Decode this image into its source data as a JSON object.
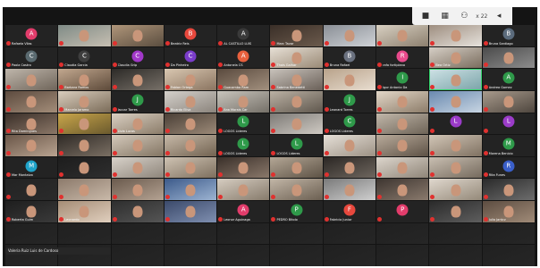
{
  "toolbar": {
    "icons": [
      "stop-icon",
      "gallery-icon",
      "group-icon",
      "minimize-icon"
    ],
    "label": "x 22",
    "glyphs": [
      "■",
      "▦",
      "⚇",
      "◂"
    ]
  },
  "name_pill": "Valeria Ruiz Luis de Cardoso",
  "colors": {
    "background": "#141414",
    "tile": "#232323",
    "mute": "#e0312f",
    "active_speaker": "#35d36b"
  },
  "participants": [
    {
      "name": "Rafaela Vilas",
      "initial": "A",
      "color": "#e23c6b"
    },
    {
      "name": "",
      "video": [
        "#7f8b86",
        "#c7bfb2"
      ]
    },
    {
      "name": "",
      "video": [
        "#b0967a",
        "#5a4d3f"
      ]
    },
    {
      "name": "Beatriz Reis",
      "initial": "B",
      "color": "#e8483d"
    },
    {
      "name": "AL CASTILLO LUIS",
      "initial": "A",
      "color": "#3a3a3a"
    },
    {
      "name": "Marc Tavar",
      "video": [
        "#3a2f28",
        "#6b5a4c"
      ]
    },
    {
      "name": "",
      "video": [
        "#8a8f96",
        "#cfd2d6"
      ]
    },
    {
      "name": "",
      "video": [
        "#d8d0c2",
        "#8c7f6e"
      ]
    },
    {
      "name": "",
      "video": [
        "#9e8e80",
        "#e6e2dc"
      ]
    },
    {
      "name": "Bruna Santiago",
      "initial": "B",
      "color": "#5b6b7c"
    },
    {
      "name": "Paola Castro",
      "initial": "C",
      "color": "#5a6a70"
    },
    {
      "name": "Claudia Garcia",
      "initial": "C",
      "color": "#3e3e3e"
    },
    {
      "name": "Claudia Grip",
      "initial": "C",
      "color": "#a138c9"
    },
    {
      "name": "Da Pinheiro",
      "initial": "C",
      "color": "#7a3cc9"
    },
    {
      "name": "Antonela CS",
      "initial": "A",
      "color": "#e8603d"
    },
    {
      "name": "Thais Galhar",
      "video": [
        "#e7e0d6",
        "#9a8a76"
      ]
    },
    {
      "name": "Bruna Rafael",
      "initial": "B",
      "color": "#6b7280"
    },
    {
      "name": "rafa fortiplano",
      "initial": "R",
      "color": "#e84a8c"
    },
    {
      "name": "Bea Ortiz",
      "video": [
        "#d6cfc6",
        "#7a6d5e"
      ]
    },
    {
      "name": "",
      "video": [
        "#4b4b4b",
        "#8d8d8d"
      ]
    },
    {
      "name": "",
      "video": [
        "#bfb6ab",
        "#6f655a"
      ]
    },
    {
      "name": "Barbara Ramos",
      "video": [
        "#c2a88f",
        "#5d4a3a"
      ]
    },
    {
      "name": "",
      "video": [
        "#2c2a27",
        "#777068"
      ]
    },
    {
      "name": "Fabian Ortega",
      "video": [
        "#d9c7b1",
        "#8a7460"
      ]
    },
    {
      "name": "Guacamba Ram",
      "video": [
        "#5a4a3e",
        "#a2907e"
      ]
    },
    {
      "name": "Sabrina Benedetti",
      "video": [
        "#c9c3bc",
        "#6a6058"
      ]
    },
    {
      "name": "",
      "video": [
        "#b8a28a",
        "#e8ddd0"
      ]
    },
    {
      "name": "Igor Antonio Da",
      "initial": "I",
      "color": "#2f9a4a"
    },
    {
      "name": "",
      "video": [
        "#cfe3e6",
        "#7aa3a8"
      ],
      "talking": true
    },
    {
      "name": "Andrea Gomez",
      "initial": "A",
      "color": "#2f9a4a"
    },
    {
      "name": "",
      "video": [
        "#5d4b3f",
        "#a38d79"
      ]
    },
    {
      "name": "Marcelo Jaramo",
      "video": [
        "#d9cdbd",
        "#7a6b58"
      ]
    },
    {
      "name": "Jaccar Torres",
      "initial": "J",
      "color": "#2f9a4a"
    },
    {
      "name": "Ricardo Elisa",
      "video": [
        "#d4d0cb",
        "#8b847c"
      ]
    },
    {
      "name": "Ana Morais Car",
      "video": [
        "#c8c4bc",
        "#757068"
      ]
    },
    {
      "name": "",
      "video": [
        "#bbb1a4",
        "#5f574d"
      ]
    },
    {
      "name": "Leonard Torres",
      "initial": "J",
      "color": "#2f9a4a"
    },
    {
      "name": "",
      "video": [
        "#e3d7c8",
        "#8c7c69"
      ]
    },
    {
      "name": "",
      "video": [
        "#6a8ab0",
        "#c8d5e2"
      ]
    },
    {
      "name": "",
      "video": [
        "#a89a8c",
        "#4e463e"
      ]
    },
    {
      "name": "Rita Domingues",
      "video": [
        "#3a2f29",
        "#8b7767"
      ]
    },
    {
      "name": "",
      "video": [
        "#c9a64a",
        "#6b5a2e"
      ]
    },
    {
      "name": "Livia Lucas",
      "video": [
        "#d9cfc2",
        "#8b7c69"
      ]
    },
    {
      "name": "",
      "video": [
        "#4a3f36",
        "#9c8a78"
      ]
    },
    {
      "name": "LOGOS Lideres",
      "initial": "L",
      "color": "#2f9a4a"
    },
    {
      "name": "",
      "video": [
        "#7d7a76",
        "#cfcac3"
      ]
    },
    {
      "name": "LOGOS Lideres",
      "initial": "C",
      "color": "#2f9a4a"
    },
    {
      "name": "",
      "video": [
        "#c1b7aa",
        "#6e6457"
      ]
    },
    {
      "name": "",
      "initial": "L",
      "color": "#9b3cc9"
    },
    {
      "name": "",
      "initial": "L",
      "color": "#9b3cc9"
    },
    {
      "name": "",
      "video": [
        "#6a5648",
        "#b8a390"
      ]
    },
    {
      "name": "",
      "video": [
        "#2f2a26",
        "#7a6f63"
      ]
    },
    {
      "name": "",
      "video": [
        "#d4c9bb",
        "#837563"
      ]
    },
    {
      "name": "",
      "video": [
        "#c7b9a8",
        "#726351"
      ]
    },
    {
      "name": "LOGOS Lideres",
      "initial": "L",
      "color": "#2f9a4a"
    },
    {
      "name": "LOGOS Lideres",
      "initial": "L",
      "color": "#2f9a4a"
    },
    {
      "name": "",
      "video": [
        "#e6e0d8",
        "#9c9184"
      ]
    },
    {
      "name": "",
      "video": [
        "#b9ab9b",
        "#5e5246"
      ]
    },
    {
      "name": "",
      "video": [
        "#d2c6b7",
        "#7f7161"
      ]
    },
    {
      "name": "Morena Benicio",
      "initial": "M",
      "color": "#2f9a4a"
    },
    {
      "name": "Mar Montalvo",
      "initial": "M",
      "color": "#1fa3c9"
    },
    {
      "name": "",
      "video": [
        "#1d1d1d",
        "#2e2e2e"
      ]
    },
    {
      "name": "",
      "video": [
        "#d8d2ca",
        "#8e857a"
      ]
    },
    {
      "name": "",
      "video": [
        "#cfc3b3",
        "#7d6f5e"
      ]
    },
    {
      "name": "",
      "video": [
        "#3a302a",
        "#8a786a"
      ]
    },
    {
      "name": "",
      "video": [
        "#b4a796",
        "#5d5245"
      ]
    },
    {
      "name": "",
      "video": [
        "#2b2724",
        "#6e665e"
      ]
    },
    {
      "name": "",
      "video": [
        "#ddd6cd",
        "#8f8578"
      ]
    },
    {
      "name": "",
      "video": [
        "#c9bfb2",
        "#756a5d"
      ]
    },
    {
      "name": "Rita Funes",
      "initial": "R",
      "color": "#3a5fc9"
    },
    {
      "name": "",
      "video": [
        "#232323",
        "#2b2b2b"
      ]
    },
    {
      "name": "",
      "video": [
        "#8c7a6b",
        "#c9b9a9"
      ]
    },
    {
      "name": "",
      "video": [
        "#6a5a4d",
        "#b4a292"
      ]
    },
    {
      "name": "",
      "video": [
        "#3c5a8a",
        "#9db4d2"
      ]
    },
    {
      "name": "",
      "video": [
        "#d6cdc1",
        "#867a6b"
      ]
    },
    {
      "name": "",
      "video": [
        "#c2b6a7",
        "#6b5f51"
      ]
    },
    {
      "name": "",
      "video": [
        "#7a7a7a",
        "#cfcfcf"
      ]
    },
    {
      "name": "",
      "video": [
        "#3d3530",
        "#8a7a6d"
      ]
    },
    {
      "name": "",
      "video": [
        "#e0d8ce",
        "#948979"
      ]
    },
    {
      "name": "",
      "video": [
        "#2a2a2a",
        "#6d6d6d"
      ]
    },
    {
      "name": "Roberta Guim",
      "video": [
        "#1e1e1e",
        "#3a3a3a"
      ]
    },
    {
      "name": "Leonardo",
      "video": [
        "#a58d76",
        "#e0cfbe"
      ]
    },
    {
      "name": "",
      "video": [
        "#2e2e2e",
        "#555555"
      ]
    },
    {
      "name": "",
      "video": [
        "#3b4a6b",
        "#7f8fb0"
      ]
    },
    {
      "name": "Leonor Aguinaga",
      "initial": "A",
      "color": "#e23c6b"
    },
    {
      "name": "PEDRO Bitolo",
      "initial": "P",
      "color": "#2f9a4a"
    },
    {
      "name": "Fabricio Junior",
      "initial": "F",
      "color": "#e8483d"
    },
    {
      "name": "",
      "initial": "P",
      "color": "#e23c6b"
    },
    {
      "name": "",
      "video": [
        "#2a2a2a",
        "#5e5e5e"
      ]
    },
    {
      "name": "Julia Jantcz",
      "video": [
        "#5d4d41",
        "#a08b78"
      ]
    },
    {
      "name": "",
      "video": [
        "#202020",
        "#262626"
      ]
    },
    {
      "name": "",
      "video": [
        "#202020",
        "#262626"
      ]
    },
    {
      "name": "",
      "video": [
        "#202020",
        "#262626"
      ]
    },
    {
      "name": "",
      "video": [
        "#202020",
        "#262626"
      ]
    },
    {
      "name": "",
      "video": [
        "#202020",
        "#262626"
      ]
    },
    {
      "name": "",
      "video": [
        "#202020",
        "#262626"
      ]
    },
    {
      "name": "",
      "video": [
        "#202020",
        "#262626"
      ]
    },
    {
      "name": "",
      "video": [
        "#202020",
        "#262626"
      ]
    },
    {
      "name": "",
      "video": [
        "#202020",
        "#262626"
      ]
    },
    {
      "name": "",
      "video": [
        "#202020",
        "#262626"
      ]
    },
    {
      "name": "",
      "video": [
        "#202020",
        "#262626"
      ]
    },
    {
      "name": "",
      "video": [
        "#202020",
        "#262626"
      ]
    },
    {
      "name": "",
      "video": [
        "#202020",
        "#262626"
      ]
    },
    {
      "name": "",
      "video": [
        "#202020",
        "#262626"
      ]
    },
    {
      "name": "",
      "video": [
        "#202020",
        "#262626"
      ]
    },
    {
      "name": "",
      "video": [
        "#202020",
        "#262626"
      ]
    },
    {
      "name": "",
      "video": [
        "#202020",
        "#262626"
      ]
    },
    {
      "name": "",
      "video": [
        "#202020",
        "#262626"
      ]
    },
    {
      "name": "",
      "video": [
        "#202020",
        "#262626"
      ]
    },
    {
      "name": "",
      "video": [
        "#202020",
        "#262626"
      ]
    }
  ]
}
